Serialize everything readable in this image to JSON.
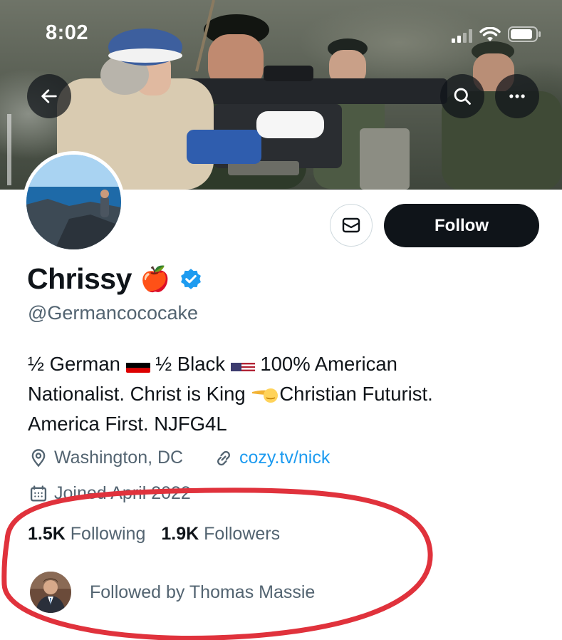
{
  "status_bar": {
    "time": "8:02"
  },
  "header": {
    "back_icon": "arrow-left-icon",
    "search_icon": "search-icon",
    "more_icon": "more-horizontal-icon"
  },
  "profile": {
    "display_name": "Chrissy",
    "name_emoji": "🍎",
    "verified": true,
    "handle": "@Germancococake",
    "bio_lines": [
      "½ German",
      "½ Black",
      "100% American",
      "Nationalist. Christ is King",
      "Christian Futurist.",
      "America First. NJFG4L"
    ],
    "location": "Washington, DC",
    "website": "cozy.tv/nick",
    "joined": "Joined April 2022",
    "following_count": "1.5K",
    "following_label": "Following",
    "followers_count": "1.9K",
    "followers_label": "Followers",
    "followed_by": "Followed by Thomas Massie"
  },
  "actions": {
    "follow_label": "Follow",
    "message_icon": "mail-icon"
  },
  "colors": {
    "accent": "#1d9bf0",
    "annotation": "#e0323c",
    "text": "#0f1419",
    "secondary": "#536471"
  }
}
